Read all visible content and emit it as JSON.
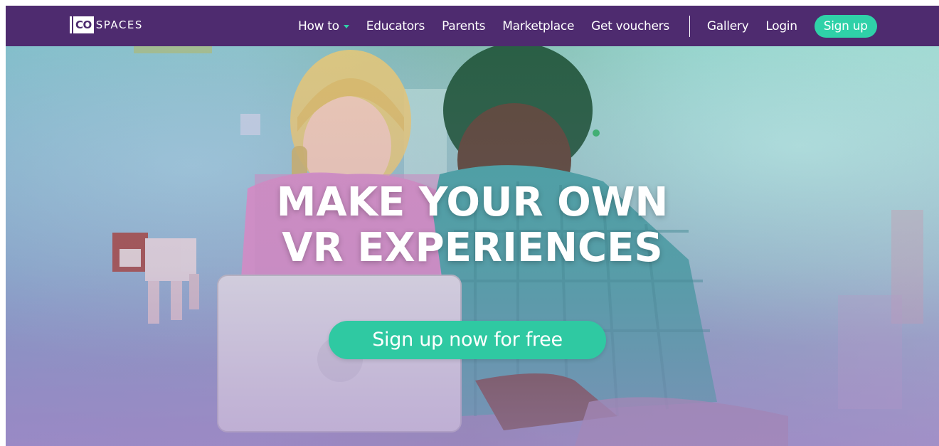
{
  "brand": {
    "logo_mark": "CO",
    "logo_text": "SPACES"
  },
  "nav": {
    "items": [
      {
        "label": "How to",
        "has_dropdown": true
      },
      {
        "label": "Educators"
      },
      {
        "label": "Parents"
      },
      {
        "label": "Marketplace"
      },
      {
        "label": "Get vouchers"
      }
    ],
    "secondary": [
      {
        "label": "Gallery"
      },
      {
        "label": "Login"
      }
    ],
    "signup_label": "Sign up",
    "dropdown_icon": "caret-down-icon"
  },
  "hero": {
    "title_line1": "MAKE YOUR OWN",
    "title_line2": "VR EXPERIENCES",
    "cta_label": "Sign up now for free"
  },
  "colors": {
    "nav_bg": "#4e2b6f",
    "accent": "#2fd1a8",
    "cta": "#2fc9a2"
  }
}
